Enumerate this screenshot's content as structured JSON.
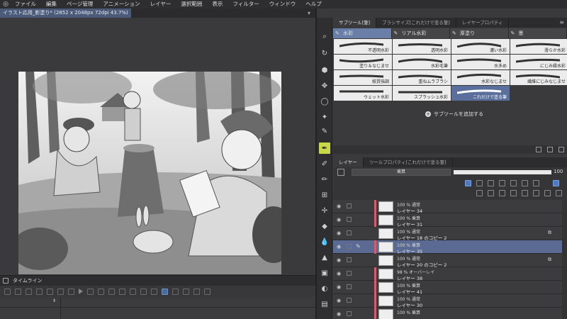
{
  "menu": {
    "items": [
      "ファイル",
      "編集",
      "ページ管理",
      "アニメーション",
      "レイヤー",
      "選択範囲",
      "表示",
      "フィルター",
      "ウィンドウ",
      "ヘルプ"
    ]
  },
  "document": {
    "tab_title": "イラスト応用_影塗り* (2852 x 2048px 72dpi 43.7%)",
    "close_glyph": "▾"
  },
  "timeline": {
    "title": "タイムライン"
  },
  "subtool_panel": {
    "tabs": [
      "サブツール[筆]",
      "ブラシサイズ[これだけで塗る筆]",
      "レイヤープロパティ"
    ],
    "groups": [
      "水彩",
      "リアル水彩",
      "厚塗り",
      "墨"
    ],
    "brushes": [
      {
        "label": "不透明水彩"
      },
      {
        "label": "透明水彩"
      },
      {
        "label": "濃い水彩"
      },
      {
        "label": "滑らか水彩"
      },
      {
        "label": "塗り＆なじませ"
      },
      {
        "label": "水彩毛筆"
      },
      {
        "label": "水多め"
      },
      {
        "label": "にじみ縁水彩"
      },
      {
        "label": "紙質強調"
      },
      {
        "label": "重ねムラブラシ"
      },
      {
        "label": "水彩なじませ"
      },
      {
        "label": "繊維にじみなじませ"
      },
      {
        "label": "ウェット水彩"
      },
      {
        "label": "スプラッシュ水彩"
      },
      {
        "label": "これだけで塗る筆"
      }
    ],
    "active_brush_index": 14,
    "add_subtool_label": "サブツールを追加する"
  },
  "layer_panel": {
    "tabs": [
      "レイヤー",
      "ツールプロパティ[これだけで塗る筆]"
    ],
    "blend_mode": "乗算",
    "opacity": 100,
    "opacity_label": "100",
    "layers": [
      {
        "mode": "100 % 通常",
        "name": "レイヤー 34",
        "clip": true,
        "selected": false,
        "mask": false
      },
      {
        "mode": "100 % 乗算",
        "name": "レイヤー 31",
        "clip": true,
        "selected": false,
        "mask": false
      },
      {
        "mode": "100 % 通常",
        "name": "レイヤー 18 のコピー 2",
        "clip": false,
        "selected": false,
        "mask": true
      },
      {
        "mode": "100 % 乗算",
        "name": "レイヤー 35",
        "clip": true,
        "selected": true,
        "mask": false
      },
      {
        "mode": "100 % 通常",
        "name": "レイヤー 20 のコピー 2",
        "clip": false,
        "selected": false,
        "mask": true
      },
      {
        "mode": "98 % オーバーレイ",
        "name": "レイヤー 38",
        "clip": true,
        "selected": false,
        "mask": false
      },
      {
        "mode": "100 % 乗算",
        "name": "レイヤー 41",
        "clip": true,
        "selected": false,
        "mask": false
      },
      {
        "mode": "100 % 通常",
        "name": "レイヤー 30",
        "clip": true,
        "selected": false,
        "mask": false
      },
      {
        "mode": "100 % 乗算",
        "name": "",
        "clip": true,
        "selected": false,
        "mask": false
      }
    ]
  },
  "colors": {
    "accent": "#5a6a92",
    "active_tool": "#c8d84a",
    "clip_bar": "#d06070"
  }
}
